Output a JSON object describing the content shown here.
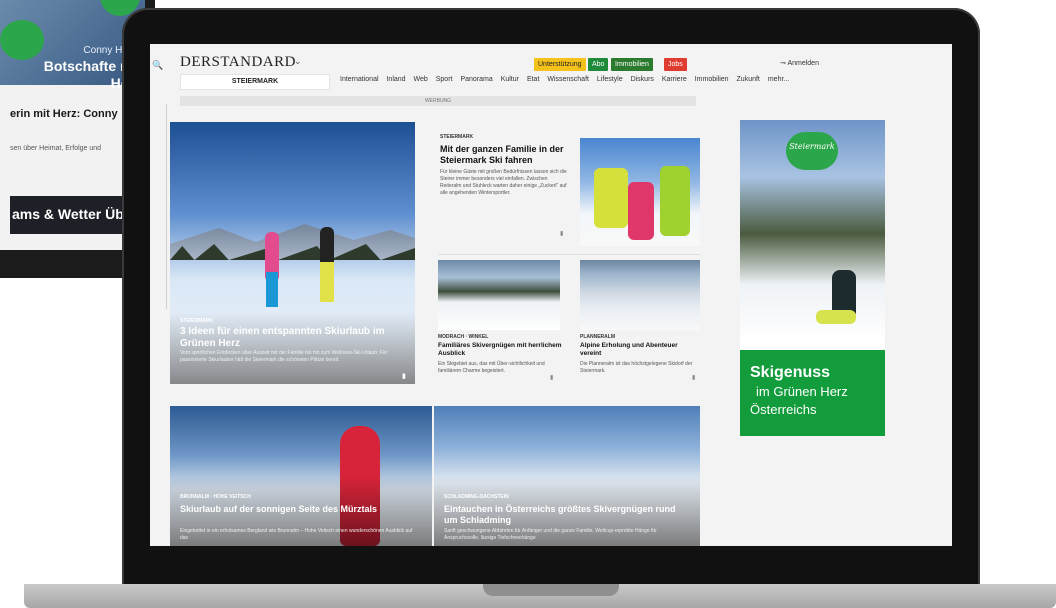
{
  "tablet": {
    "hero_name": "Conny Hütte",
    "hero_title": "Botschafte mit Herz",
    "headline": "erin mit Herz: Conny",
    "text": "sen über Heimat, Erfolge und",
    "bar_text": "ams & Wetter Üb"
  },
  "header": {
    "logo": "DERSTANDARD",
    "logo_caret": "⌄",
    "search_icon": "🔍",
    "btn_support": "Unterstützung",
    "btn_abo": "Abo",
    "btn_immo": "Immobilien",
    "btn_jobs": "Jobs",
    "login": "Anmelden",
    "region": "STEIERMARK",
    "nav": [
      "International",
      "Inland",
      "Web",
      "Sport",
      "Panorama",
      "Kultur",
      "Etat",
      "Wissenschaft",
      "Lifestyle",
      "Diskurs",
      "Karriere",
      "Immobilien",
      "Zukunft",
      "mehr..."
    ],
    "ad_label": "WERBUNG"
  },
  "articles": {
    "big": {
      "kicker": "STEIERMARK",
      "title": "3 Ideen für einen entspannten Skiurlaub im Grünen Herz",
      "text": "Vom sportlichen Entdecken über Auszeit mit der Familie bis hin zum Wellness-Ski-Urlaub: Für passionierte Skiurlauber hält die Steiermark die schönsten Plätze bereit."
    },
    "family": {
      "kicker": "STEIERMARK",
      "title": "Mit der ganzen Familie in der Steiermark Ski fahren",
      "text": "Für kleine Gäste mit großen Bedürfnissen lassen sich die Steirer immer besonders viel einfallen. Zwischen Reiteralm und Stuhleck warten daher einige „Zuckerl\" auf alle angehenden Wintersportler."
    },
    "moodrach": {
      "kicker": "MODRACH · WINKEL",
      "title": "Familiäres Skivergnügen mit herrlichem Ausblick",
      "text": "Ein Skigebiet aus, das mit Über-sichtlichkeit und familiärem Charme begeistert."
    },
    "planneralm": {
      "kicker": "PLANNERALM",
      "title": "Alpine Erholung und Abenteuer vereint",
      "text": "Die Planneralm ist das höchstgelegene Skidorf der Steiermark."
    },
    "brunnalm": {
      "kicker": "BRUNNALM · HOHE VEITSCH",
      "title": "Skiurlaub auf der sonnigen Seite des Mürztals",
      "text": "Eingebettet in ein erholsames Bergland wie Brunnalm – Hohe Veitsch einen wunderschönen Ausblick auf das"
    },
    "schladming": {
      "kicker": "SCHLADMING-DACHSTEIN",
      "title": "Eintauchen in Österreichs größtes Skivergnügen rund um Schladming",
      "text": "Sanft geschwungene Abfahrten für Anfänger und die ganze Familie, Weltcup-erprobte Hänge für Anspruchsvolle, lässige Tiefschneehänge"
    }
  },
  "ad": {
    "logo": "Steiermark",
    "line1": "Skigenuss",
    "line2": "im Grünen Herz",
    "line3": "Österreichs"
  },
  "icons": {
    "bookmark": "▮",
    "key": "⊸"
  }
}
